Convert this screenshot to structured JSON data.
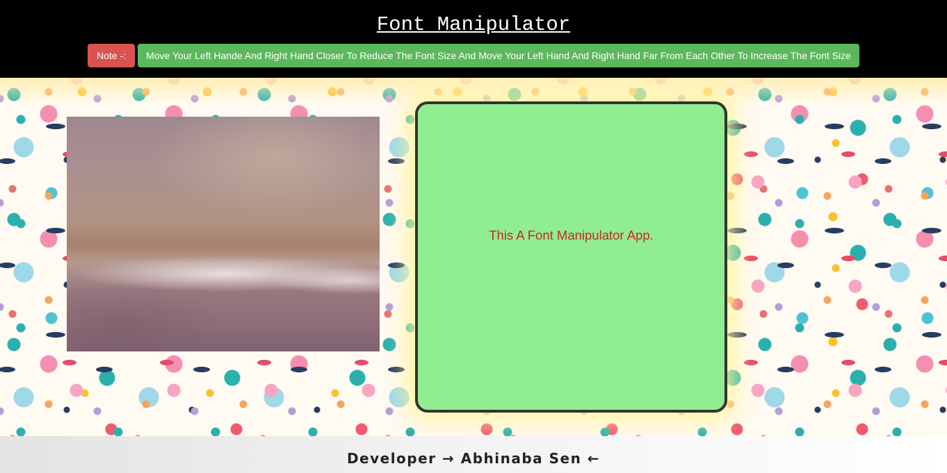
{
  "header": {
    "title": "Font Manipulator"
  },
  "note": {
    "label": "Note -:",
    "message": "Move Your Left Hande And Right Hand Closer To Reduce The Font Size And Move Your Left Hand And Right Hand Far From Each Other To Increase The Font Size"
  },
  "display": {
    "text": "This A Font Manipulator App."
  },
  "footer": {
    "text": "Developer → Abhinaba Sen ←"
  },
  "colors": {
    "header_background": "#000000",
    "note_label_background": "#d9534f",
    "note_message_background": "#5cb85c",
    "display_background": "#90ee90",
    "display_border": "#333333",
    "display_text": "#c62828"
  }
}
